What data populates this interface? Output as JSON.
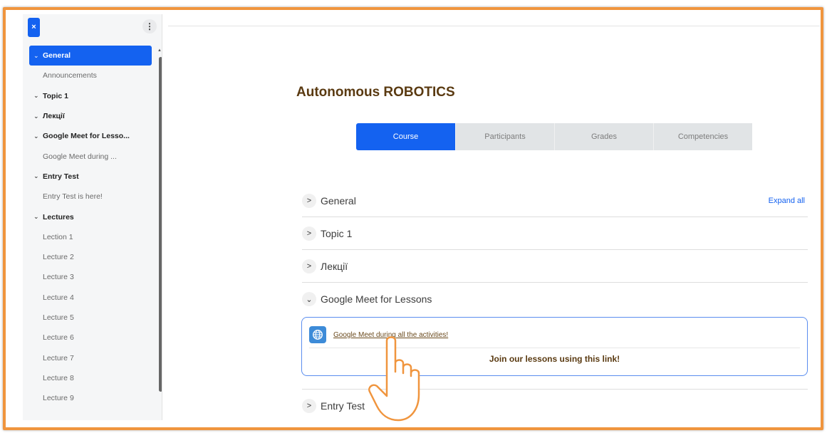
{
  "drawer": {
    "close_label": "×",
    "menu_label": "⋮",
    "items": [
      {
        "label": "General",
        "type": "section",
        "active": true
      },
      {
        "label": "Announcements",
        "type": "activity"
      },
      {
        "label": "Topic 1",
        "type": "section"
      },
      {
        "label": "Лекції",
        "type": "section"
      },
      {
        "label": "Google Meet for Lesso...",
        "type": "section"
      },
      {
        "label": "Google Meet during ...",
        "type": "activity"
      },
      {
        "label": "Entry Test",
        "type": "section"
      },
      {
        "label": "Entry Test is here!",
        "type": "activity"
      },
      {
        "label": "Lectures",
        "type": "section"
      },
      {
        "label": "Lection 1",
        "type": "activity"
      },
      {
        "label": "Lecture 2",
        "type": "activity"
      },
      {
        "label": "Lecture 3",
        "type": "activity"
      },
      {
        "label": "Lecture 4",
        "type": "activity"
      },
      {
        "label": "Lecture 5",
        "type": "activity"
      },
      {
        "label": "Lecture 6",
        "type": "activity"
      },
      {
        "label": "Lecture 7",
        "type": "activity"
      },
      {
        "label": "Lecture 8",
        "type": "activity"
      },
      {
        "label": "Lecture 9",
        "type": "activity"
      }
    ]
  },
  "course": {
    "title": "Autonomous ROBOTICS",
    "tabs": [
      {
        "label": "Course",
        "active": true
      },
      {
        "label": "Participants"
      },
      {
        "label": "Grades"
      },
      {
        "label": "Competencies"
      }
    ],
    "expand_all": "Expand all",
    "sections": [
      {
        "title": "General",
        "collapsed": true
      },
      {
        "title": "Topic 1",
        "collapsed": true
      },
      {
        "title": "Лекції",
        "collapsed": true
      },
      {
        "title": "Google Meet for Lessons",
        "collapsed": false
      },
      {
        "title": "Entry Test",
        "collapsed": true
      }
    ],
    "activity": {
      "link": "Google Meet during all the activities!",
      "description": "Join our lessons using this link!"
    }
  },
  "colors": {
    "accent": "#1462f0",
    "frame": "#f0953e",
    "title": "#5a3a11"
  }
}
